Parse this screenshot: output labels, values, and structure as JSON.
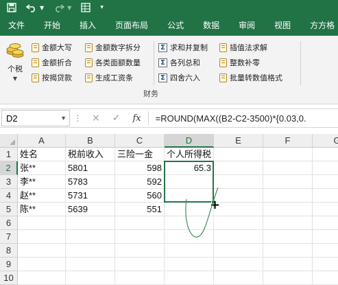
{
  "ribbon_tabs": [
    "文件",
    "开始",
    "插入",
    "页面布局",
    "公式",
    "数据",
    "审阅",
    "视图",
    "方方格"
  ],
  "ribbon": {
    "big_button_label": "个税",
    "col1": [
      "金额大写",
      "金额折合",
      "按揭贷款"
    ],
    "col2": [
      "金额数字拆分",
      "各类面额数量",
      "生成工资条"
    ],
    "col3": [
      "求和并复制",
      "各列总和",
      "四舍六入"
    ],
    "col4": [
      "插值法求解",
      "整数补零",
      "批量转数值格式"
    ],
    "group_label": "财务"
  },
  "formula_bar": {
    "name_box": "D2",
    "cancel_symbol": "×",
    "enter_symbol": "✓",
    "fx_label": "fx",
    "formula": "=ROUND(MAX((B2-C2-3500)*{0.03,0."
  },
  "sheet": {
    "columns": [
      "A",
      "B",
      "C",
      "D",
      "E",
      "F",
      "G"
    ],
    "rows": [
      "1",
      "2",
      "3",
      "4",
      "5",
      "6",
      "7",
      "8",
      "9",
      "10"
    ],
    "header_row": [
      "姓名",
      "税前收入",
      "三险一金",
      "个人所得税"
    ],
    "data_rows": [
      [
        "张**",
        "5801",
        "598",
        "65.3"
      ],
      [
        "李**",
        "5783",
        "592",
        ""
      ],
      [
        "赵**",
        "5731",
        "560",
        ""
      ],
      [
        "陈**",
        "5639",
        "551",
        ""
      ]
    ],
    "active_cell": "D2",
    "selection_color": "#217346"
  },
  "colors": {
    "brand": "#217346",
    "ribbon_bg": "#f3f3f3",
    "annotation": "#3f8a5a"
  }
}
